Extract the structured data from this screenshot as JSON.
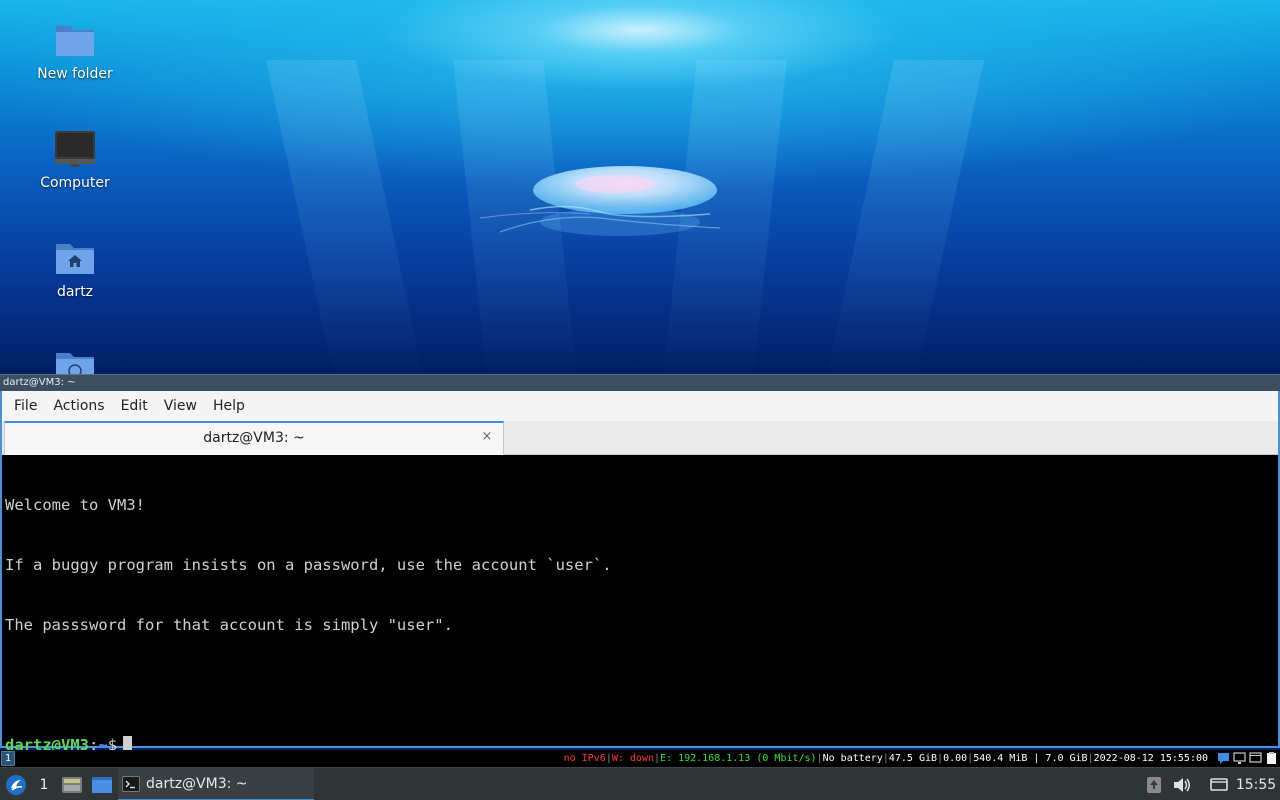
{
  "desktop": {
    "icons": [
      {
        "label": "New folder",
        "icon": "folder-icon"
      },
      {
        "label": "Computer",
        "icon": "computer-icon"
      },
      {
        "label": "dartz",
        "icon": "home-folder-icon"
      },
      {
        "label": "",
        "icon": "network-folder-icon"
      }
    ]
  },
  "terminal": {
    "window_title": "dartz@VM3: ~",
    "menu": [
      "File",
      "Actions",
      "Edit",
      "View",
      "Help"
    ],
    "tab_title": "dartz@VM3: ~",
    "tab_close_glyph": "×",
    "lines": [
      "Welcome to VM3!",
      "If a buggy program insists on a password, use the account `user`.",
      "The passsword for that account is simply \"user\"."
    ],
    "prompt": {
      "user_host": "dartz@VM3",
      "colon": ":",
      "path": "~",
      "symbol": "$"
    }
  },
  "statusbar": {
    "workspace": "1",
    "ipv6": "no IPv6",
    "wireless": "W: down",
    "ethernet": "E: 192.168.1.13 (0 Mbit/s)",
    "battery": "No battery",
    "disk": "47.5 GiB",
    "load": "0.00",
    "memory": "540.4 MiB | 7.0 GiB",
    "datetime": "2022-08-12 15:55:00",
    "separator": "|"
  },
  "panel": {
    "desktop_number": "1",
    "task_label": "dartz@VM3: ~",
    "clock": "15:55"
  },
  "colors": {
    "accent": "#3d8ee0",
    "prompt_user": "#5fd75f",
    "prompt_path": "#5f87ff",
    "status_red": "#ff3b3b",
    "status_green": "#33e033",
    "panel_bg": "#2f3437"
  }
}
